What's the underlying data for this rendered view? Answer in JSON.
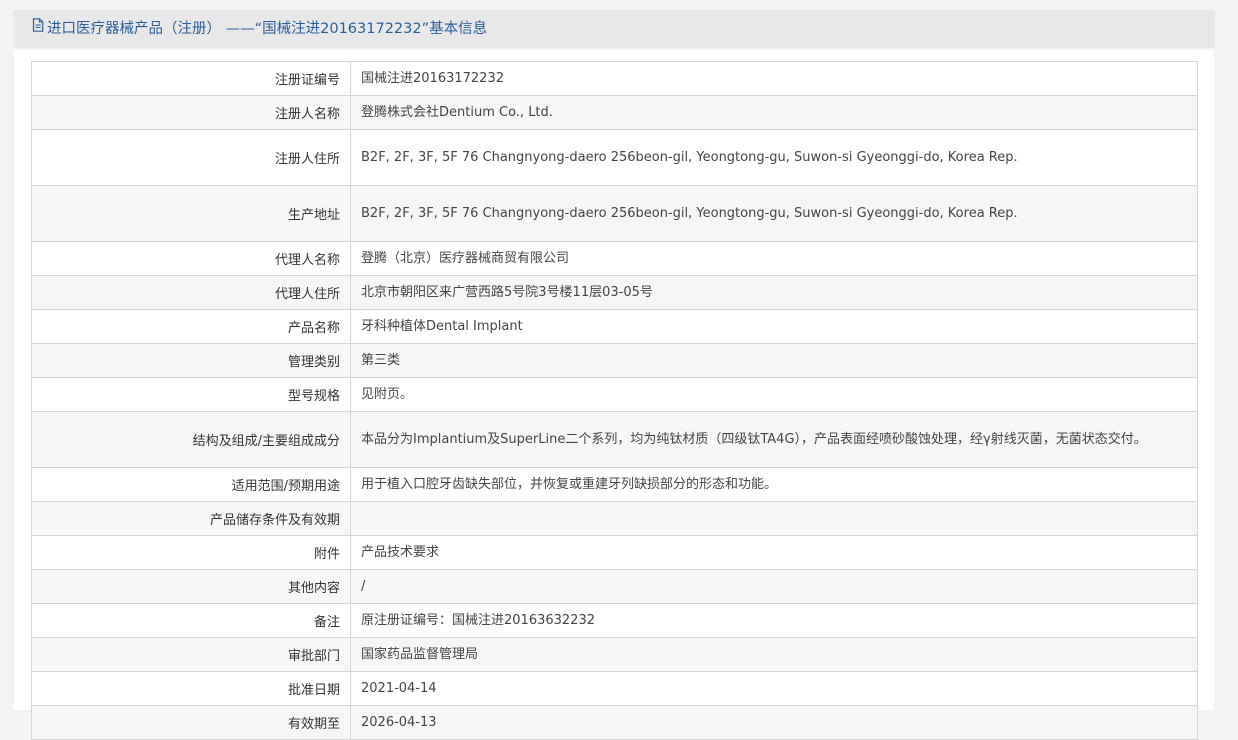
{
  "header": {
    "title": "进口医疗器械产品（注册） ——“国械注进20163172232”基本信息",
    "icon": "document-icon"
  },
  "rows": [
    {
      "label": "注册证编号",
      "value": "国械注进20163172232"
    },
    {
      "label": "注册人名称",
      "value": "登腾株式会社Dentium Co., Ltd."
    },
    {
      "label": "注册人住所",
      "value": "B2F, 2F, 3F, 5F 76 Changnyong-daero 256beon-gil, Yeongtong-gu, Suwon-si Gyeonggi-do, Korea Rep."
    },
    {
      "label": "生产地址",
      "value": "B2F, 2F, 3F, 5F 76 Changnyong-daero 256beon-gil, Yeongtong-gu, Suwon-si Gyeonggi-do, Korea Rep."
    },
    {
      "label": "代理人名称",
      "value": "登腾（北京）医疗器械商贸有限公司"
    },
    {
      "label": "代理人住所",
      "value": "北京市朝阳区来广营西路5号院3号楼11层03-05号"
    },
    {
      "label": "产品名称",
      "value": "牙科种植体Dental Implant"
    },
    {
      "label": "管理类别",
      "value": "第三类"
    },
    {
      "label": "型号规格",
      "value": "见附页。"
    },
    {
      "label": "结构及组成/主要组成成分",
      "value": "本品分为Implantium及SuperLine二个系列，均为纯钛材质（四级钛TA4G），产品表面经喷砂酸蚀处理，经γ射线灭菌，无菌状态交付。"
    },
    {
      "label": "适用范围/预期用途",
      "value": "用于植入口腔牙齿缺失部位，并恢复或重建牙列缺损部分的形态和功能。"
    },
    {
      "label": "产品储存条件及有效期",
      "value": ""
    },
    {
      "label": "附件",
      "value": "产品技术要求"
    },
    {
      "label": "其他内容",
      "value": "/"
    },
    {
      "label": "备注",
      "value": "原注册证编号：国械注进20163632232"
    },
    {
      "label": "审批部门",
      "value": "国家药品监督管理局"
    },
    {
      "label": "批准日期",
      "value": "2021-04-14"
    },
    {
      "label": "有效期至",
      "value": "2026-04-13"
    }
  ]
}
